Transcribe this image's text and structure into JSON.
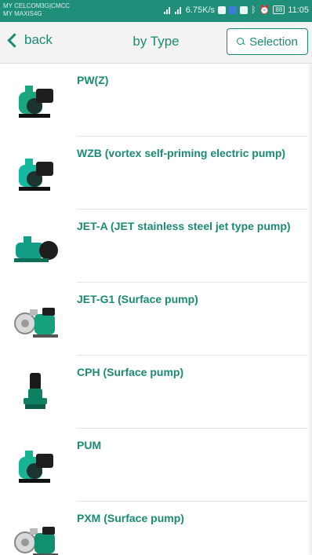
{
  "status_bar": {
    "carrier_line1": "MY CELCOM3G|CMCC",
    "carrier_line2": "MY MAXIS4G",
    "network_speed": "6.75K/s",
    "battery": "88",
    "time": "11:05"
  },
  "header": {
    "back_label": "back",
    "title": "by Type",
    "selection_label": "Selection"
  },
  "items": [
    {
      "label": "PW(Z)",
      "icon": "pump-pw-icon",
      "color": "#1aa57f"
    },
    {
      "label": "WZB (vortex self-priming electric pump)",
      "icon": "pump-wzb-icon",
      "color": "#17b8a0"
    },
    {
      "label": "JET-A (JET stainless steel jet type pump)",
      "icon": "pump-jet-a-icon",
      "color": "#149e86"
    },
    {
      "label": "JET-G1 (Surface pump)",
      "icon": "pump-jet-g1-icon",
      "color": "#14a17c"
    },
    {
      "label": "CPH (Surface pump)",
      "icon": "pump-cph-icon",
      "color": "#0f7f62"
    },
    {
      "label": "PUM",
      "icon": "pump-pum-icon",
      "color": "#18b393"
    },
    {
      "label": "PXM (Surface pump)",
      "icon": "pump-pxm-icon",
      "color": "#128f6e"
    }
  ],
  "colors": {
    "accent": "#1b8a73",
    "status_bar": "#1f8f7a"
  }
}
